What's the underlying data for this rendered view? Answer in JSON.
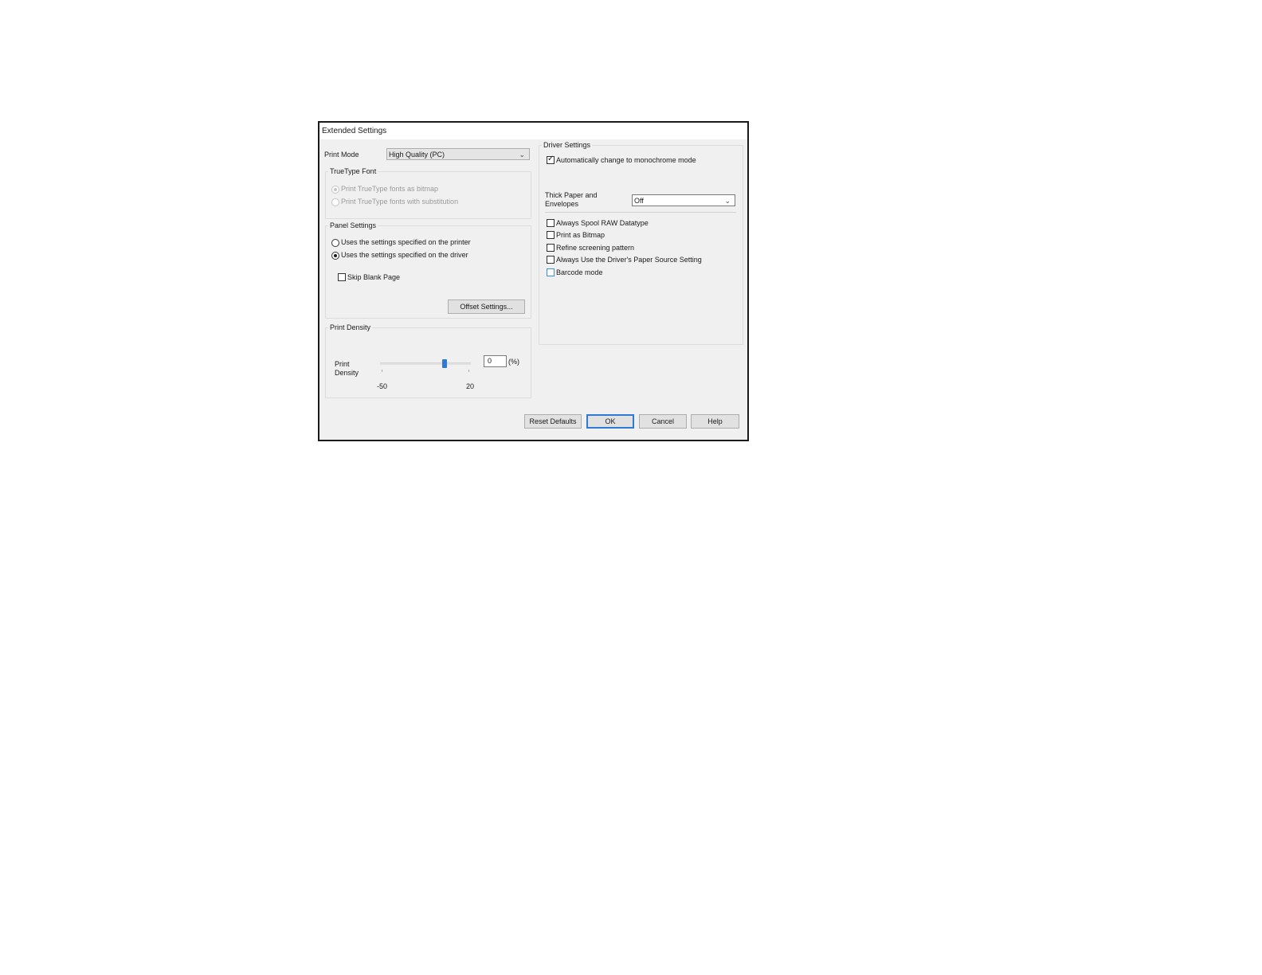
{
  "dialog": {
    "title": "Extended Settings",
    "print_mode": {
      "label": "Print Mode",
      "value": "High Quality (PC)"
    },
    "truetype": {
      "legend": "TrueType Font",
      "options": [
        "Print TrueType fonts as bitmap",
        "Print TrueType fonts with substitution"
      ],
      "selected_index": 0,
      "disabled": true
    },
    "panel": {
      "legend": "Panel Settings",
      "options": [
        "Uses the settings specified on the printer",
        "Uses the settings specified on the driver"
      ],
      "selected_index": 1,
      "skip_blank_label": "Skip Blank Page",
      "skip_blank_checked": false,
      "offset_button": "Offset Settings..."
    },
    "density": {
      "legend": "Print Density",
      "label_line1": "Print",
      "label_line2": "Density",
      "min_label": "-50",
      "max_label": "20",
      "value": "0",
      "unit": "(%)",
      "slider_value": 0,
      "slider_min": -50,
      "slider_max": 20
    },
    "driver": {
      "legend": "Driver Settings",
      "auto_mono_label": "Automatically change to monochrome mode",
      "auto_mono_checked": true,
      "thick_label_line1": "Thick Paper and",
      "thick_label_line2": "Envelopes",
      "thick_value": "Off",
      "checkboxes": [
        {
          "label": "Always Spool RAW Datatype",
          "checked": false
        },
        {
          "label": "Print as Bitmap",
          "checked": false
        },
        {
          "label": "Refine screening pattern",
          "checked": false
        },
        {
          "label": "Always Use the Driver's Paper Source Setting",
          "checked": false
        },
        {
          "label": "Barcode mode",
          "checked": false
        }
      ]
    },
    "buttons": {
      "reset": "Reset Defaults",
      "ok": "OK",
      "cancel": "Cancel",
      "help": "Help"
    }
  }
}
